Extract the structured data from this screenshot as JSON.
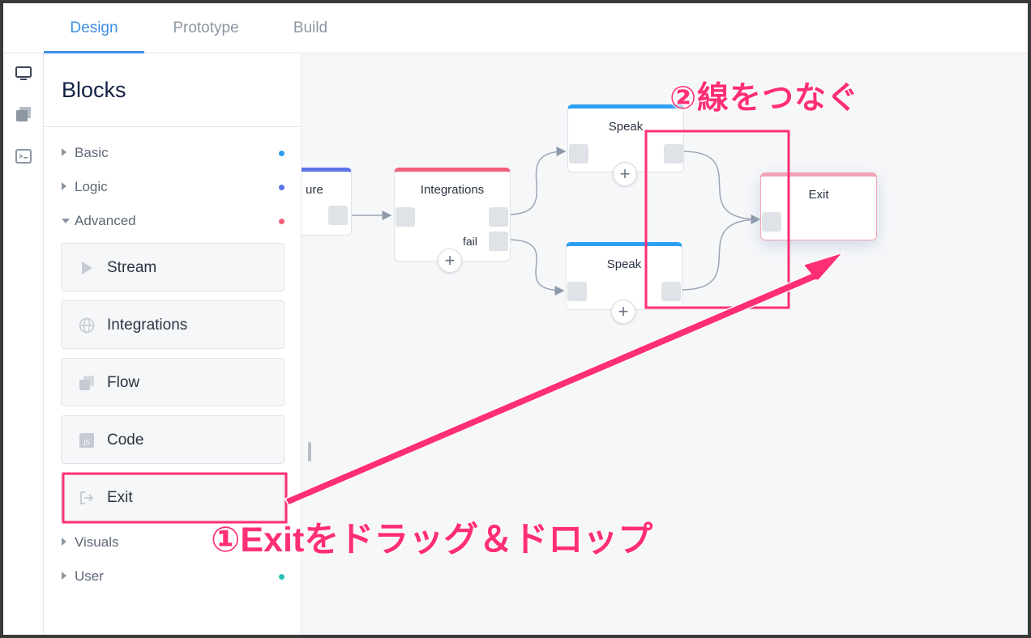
{
  "tabs": [
    {
      "label": "Design",
      "active": true
    },
    {
      "label": "Prototype",
      "active": false
    },
    {
      "label": "Build",
      "active": false
    }
  ],
  "rail": {
    "icons": [
      "display-icon",
      "layers-icon",
      "terminal-icon"
    ]
  },
  "panel": {
    "title": "Blocks",
    "sections": {
      "basic": {
        "label": "Basic",
        "dot_color": "#2e9ff0"
      },
      "logic": {
        "label": "Logic",
        "dot_color": "#5a73e8"
      },
      "advanced": {
        "label": "Advanced",
        "dot_color": "#f0607a"
      },
      "visuals": {
        "label": "Visuals"
      },
      "user": {
        "label": "User",
        "dot_color": "#27c2b6"
      }
    },
    "advanced_items": [
      {
        "label": "Stream",
        "icon": "play-icon"
      },
      {
        "label": "Integrations",
        "icon": "globe-icon"
      },
      {
        "label": "Flow",
        "icon": "layers-icon"
      },
      {
        "label": "Code",
        "icon": "js-icon"
      },
      {
        "label": "Exit",
        "icon": "exit-icon"
      }
    ]
  },
  "canvas": {
    "nodes": {
      "capture": {
        "title": "ure",
        "color": "#5a73e8"
      },
      "integrations": {
        "title": "Integrations",
        "color": "#f0607a",
        "fail_label": "fail"
      },
      "speak1": {
        "title": "Speak",
        "color": "#2e9ff0"
      },
      "speak2": {
        "title": "Speak",
        "color": "#2e9ff0"
      },
      "exit": {
        "title": "Exit",
        "color": "#f0607a"
      }
    },
    "plus_symbol": "+"
  },
  "annotations": {
    "step1": "①Exitをドラッグ＆ドロップ",
    "step2": "②線をつなぐ",
    "highlight_color": "#ff2f73"
  }
}
